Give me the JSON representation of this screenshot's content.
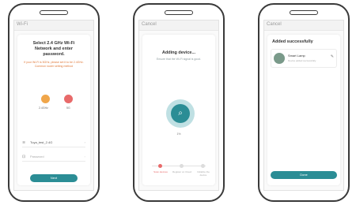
{
  "screen1": {
    "back_label": "Wi-Fi",
    "title": "Select 2.4 GHz Wi-Fi Network and enter password.",
    "note": "If your Wi-Fi is 5GHz, please set it to be 2.4GHz. Common router setting method",
    "option_a": "2.4GHz",
    "option_b": "5G",
    "wifi_value": "Tuya_test_2.4G",
    "password_placeholder": "Password",
    "next_label": "Next"
  },
  "screen2": {
    "back_label": "Cancel",
    "title": "Adding device...",
    "note": "Ensure that the Wi-Fi signal is good.",
    "progress_value": "1%",
    "steps": [
      "Scan devices",
      "Register on Cloud",
      "Initialize the device"
    ]
  },
  "screen3": {
    "back_label": "Cancel",
    "title": "Added successfully",
    "device_name": "Smart Lamp",
    "device_status": "Device added successfully",
    "done_label": "Done"
  },
  "colors": {
    "accent": "#2b8d95",
    "warning": "#e07a3a",
    "orange_dot": "#f0a64a",
    "red_dot": "#e86a6a"
  }
}
